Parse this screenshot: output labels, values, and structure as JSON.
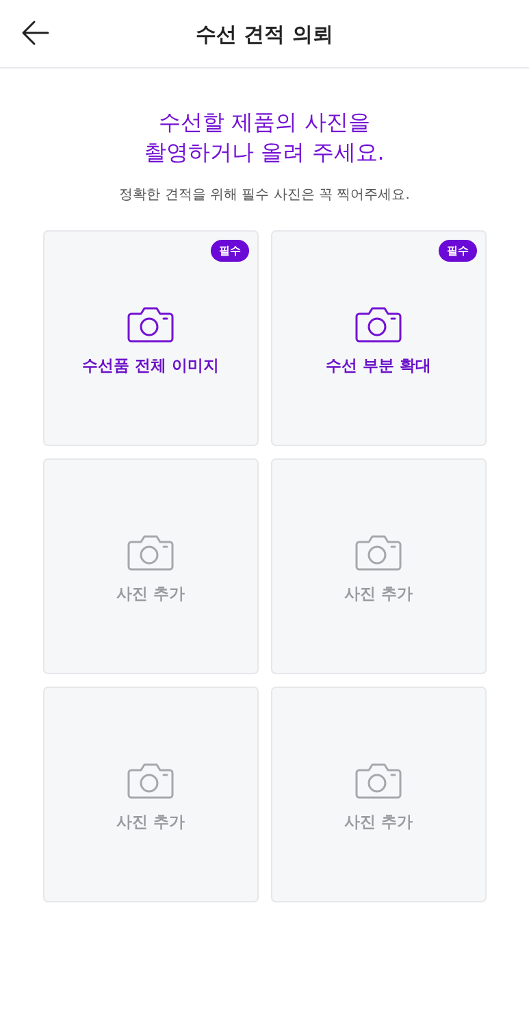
{
  "header": {
    "title": "수선 견적 의뢰"
  },
  "headline": [
    "수선할 제품의 사진을",
    "촬영하거나 올려 주세요."
  ],
  "subtitle": "정확한 견적을 위해 필수 사진은 꼭 찍어주세요.",
  "slots": [
    {
      "label": "수선품 전체 이미지",
      "required": true,
      "badge": "필수"
    },
    {
      "label": "수선 부분 확대",
      "required": true,
      "badge": "필수"
    },
    {
      "label": "사진 추가",
      "required": false
    },
    {
      "label": "사진 추가",
      "required": false
    },
    {
      "label": "사진 추가",
      "required": false
    },
    {
      "label": "사진 추가",
      "required": false
    }
  ]
}
